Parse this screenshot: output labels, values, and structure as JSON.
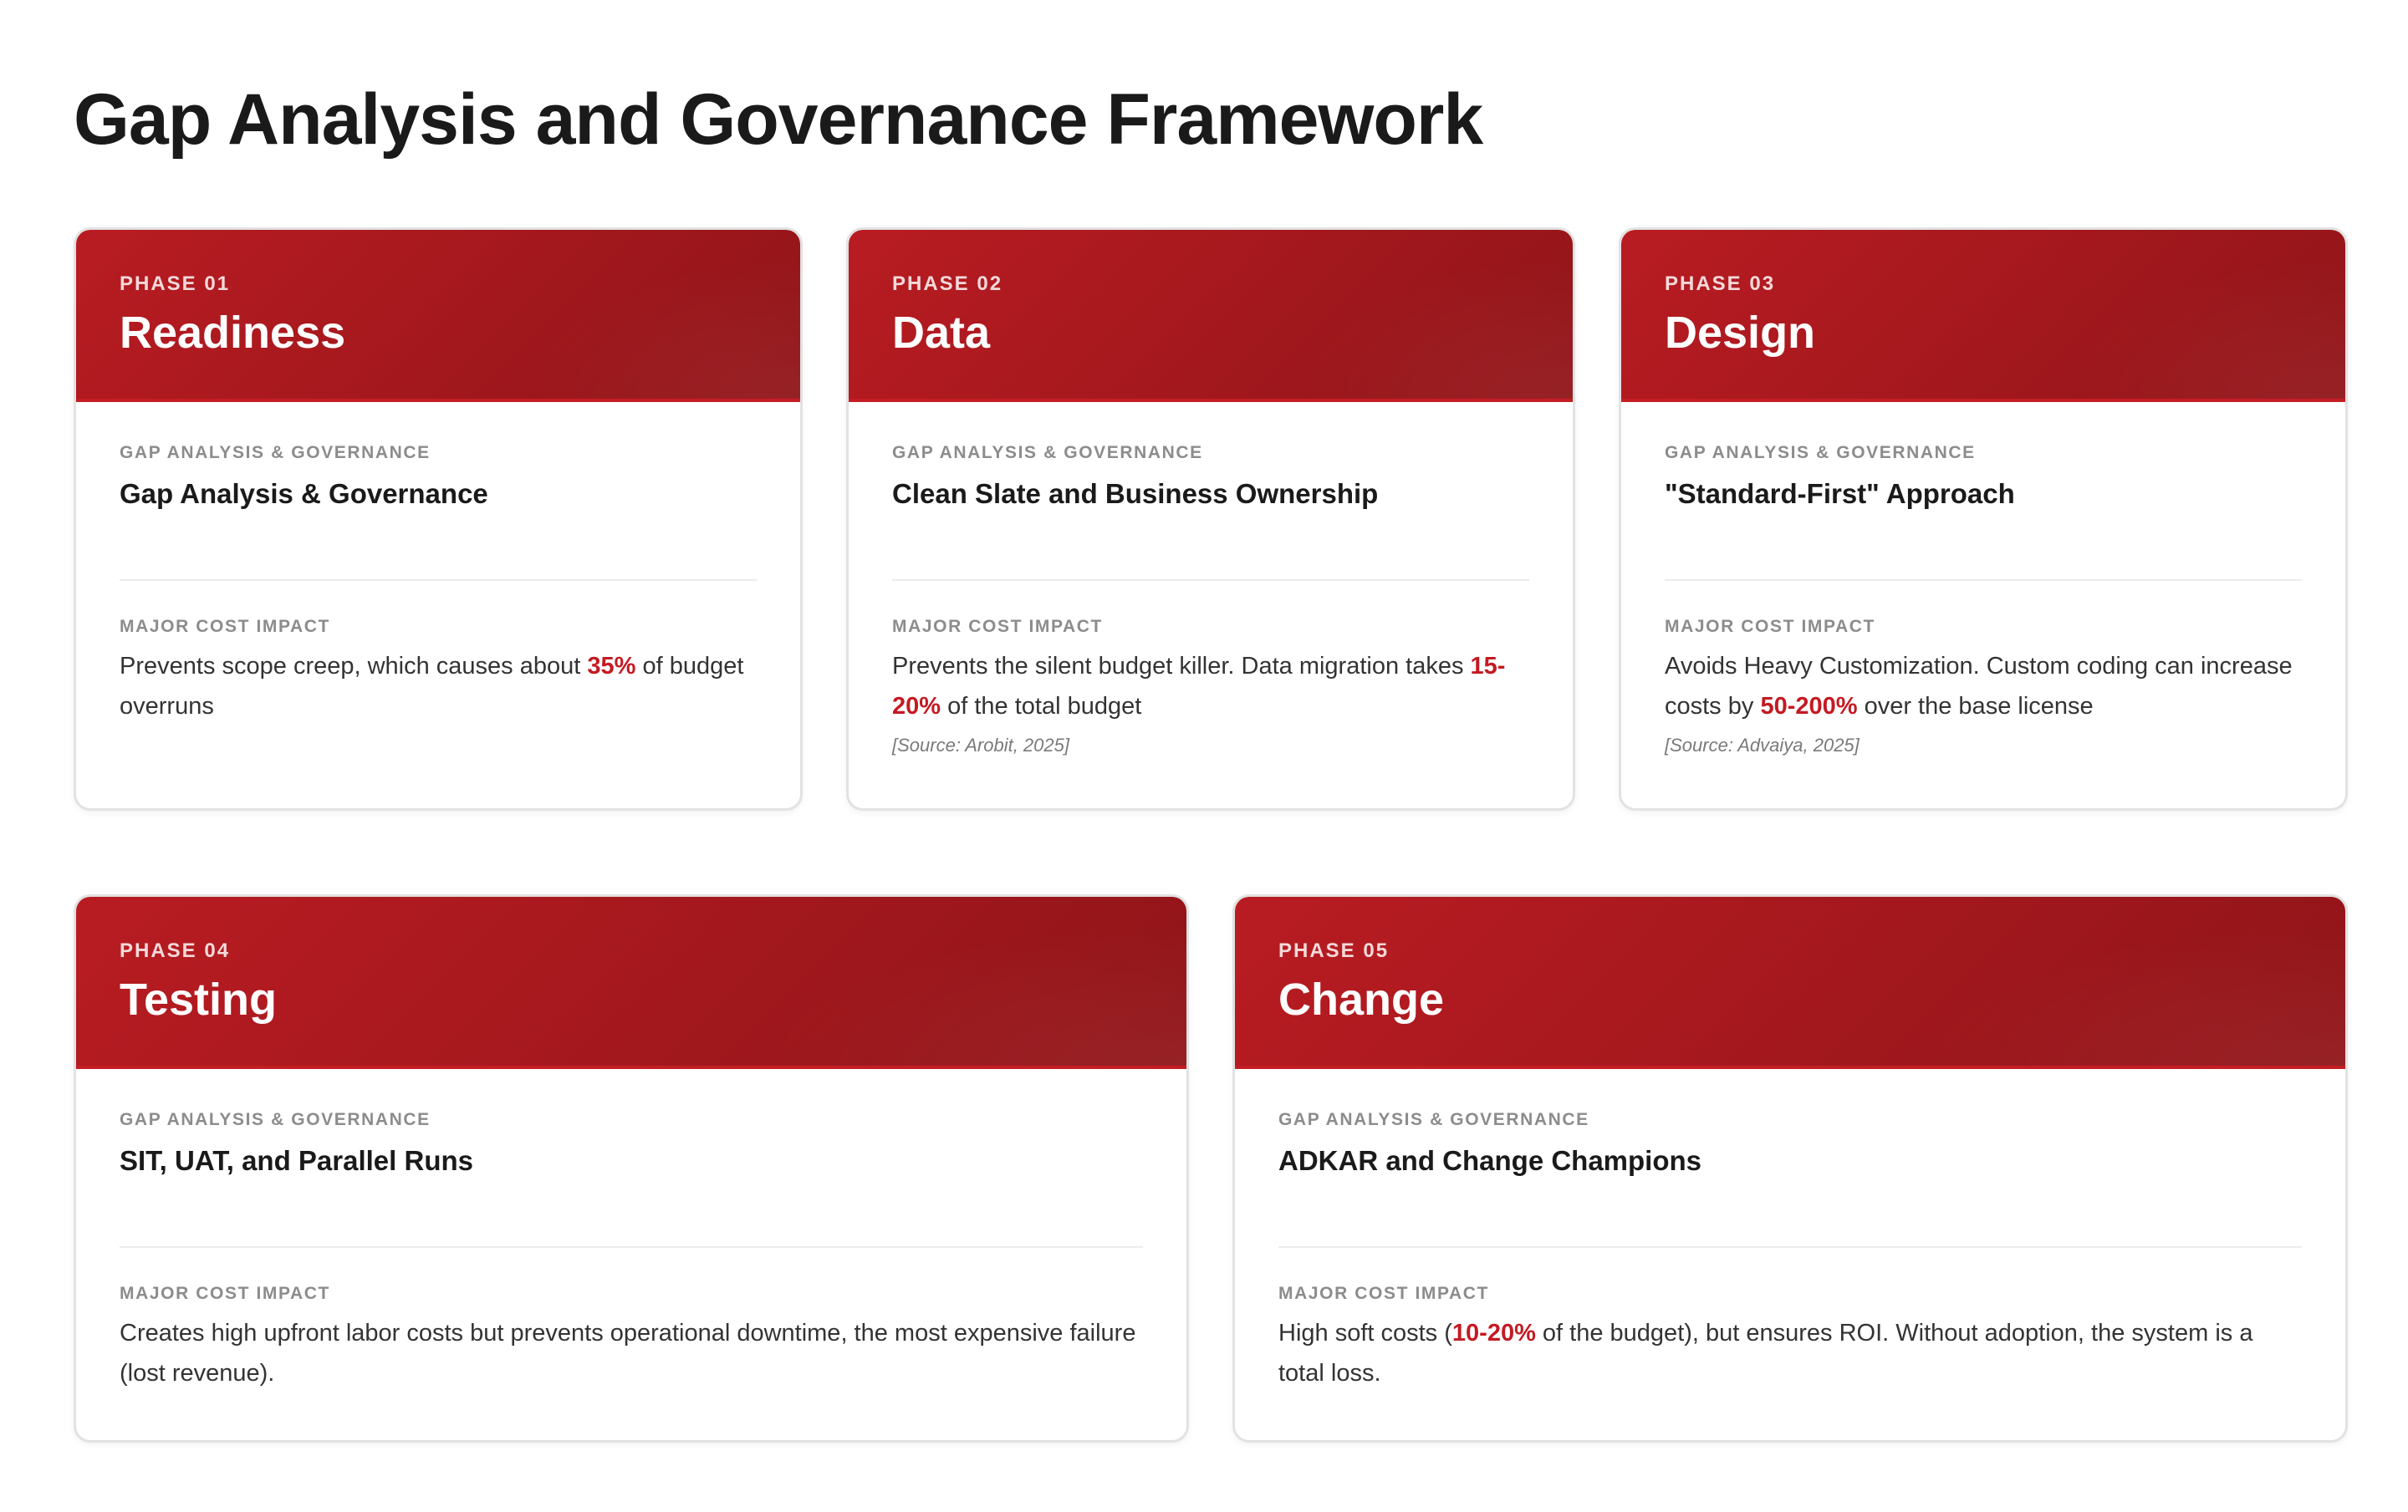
{
  "title": "Gap Analysis and Governance Framework",
  "colors": {
    "accent": "#a3181d",
    "highlight": "#c41a22"
  },
  "cards": [
    {
      "phase": "PHASE 01",
      "title": "Readiness",
      "section_label": "GAP ANALYSIS & GOVERNANCE",
      "section_title": "Gap Analysis & Governance",
      "impact_label": "MAJOR COST IMPACT",
      "impact_pre": "Prevents scope creep, which causes about ",
      "impact_hl": "35%",
      "impact_post": " of budget overruns",
      "source": ""
    },
    {
      "phase": "PHASE 02",
      "title": "Data",
      "section_label": "GAP ANALYSIS & GOVERNANCE",
      "section_title": "Clean Slate and Business Ownership",
      "impact_label": "MAJOR COST IMPACT",
      "impact_pre": "Prevents the silent budget killer. Data migration takes ",
      "impact_hl": "15-20%",
      "impact_post": " of the total budget",
      "source": "[Source: Arobit, 2025]"
    },
    {
      "phase": "PHASE 03",
      "title": "Design",
      "section_label": "GAP ANALYSIS & GOVERNANCE",
      "section_title": "\"Standard-First\" Approach",
      "impact_label": "MAJOR COST IMPACT",
      "impact_pre": "Avoids Heavy Customization. Custom coding can increase costs by ",
      "impact_hl": "50-200%",
      "impact_post": " over the base license",
      "source": "[Source: Advaiya, 2025]"
    },
    {
      "phase": "PHASE 04",
      "title": "Testing",
      "section_label": "GAP ANALYSIS & GOVERNANCE",
      "section_title": "SIT, UAT, and Parallel Runs",
      "impact_label": "MAJOR COST IMPACT",
      "impact_pre": "Creates high upfront labor costs but prevents operational downtime, the most expensive failure (lost revenue).",
      "impact_hl": "",
      "impact_post": "",
      "source": ""
    },
    {
      "phase": "PHASE 05",
      "title": "Change",
      "section_label": "GAP ANALYSIS & GOVERNANCE",
      "section_title": "ADKAR and Change Champions",
      "impact_label": "MAJOR COST IMPACT",
      "impact_pre": "High soft costs (",
      "impact_hl": "10-20%",
      "impact_post": " of the budget), but ensures ROI. Without adoption, the system is a total loss.",
      "source": ""
    }
  ]
}
